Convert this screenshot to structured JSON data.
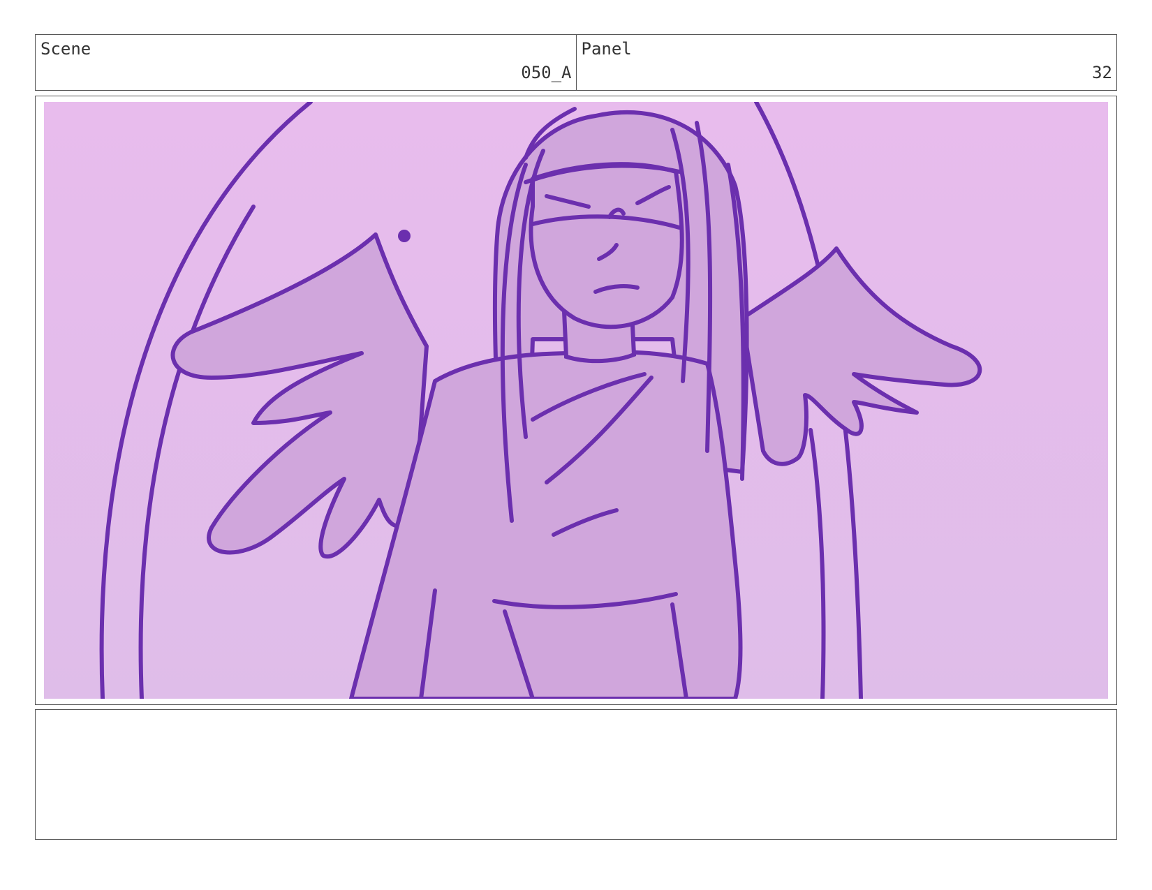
{
  "header": {
    "scene_label": "Scene",
    "scene_value": "050_A",
    "panel_label": "Panel",
    "panel_value": "32"
  },
  "artwork": {
    "background_color": "#e6bdec",
    "fill_color": "#d0a6dc",
    "line_color": "#6b2fae"
  },
  "notes": {
    "text": ""
  }
}
